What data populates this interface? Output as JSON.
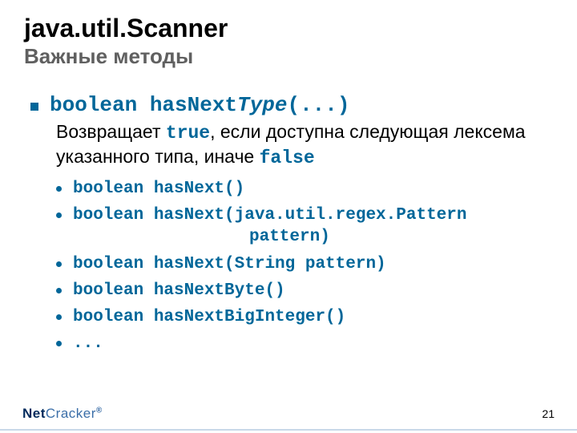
{
  "title": "java.util.Scanner",
  "subtitle": "Важные методы",
  "mainSig": {
    "prefix": "boolean hasNext",
    "ital": "Type",
    "suffix": "(...)"
  },
  "desc": {
    "t1": "Возвращает ",
    "true": "true",
    "t2": ", если доступна следующая лексема указанного типа, иначе ",
    "false": "false"
  },
  "subs": [
    {
      "line": "boolean hasNext()"
    },
    {
      "line": "boolean hasNext(java.util.regex.Pattern",
      "cont": "pattern)"
    },
    {
      "line": "boolean hasNext(String pattern)"
    },
    {
      "line": "boolean hasNextByte()"
    },
    {
      "line": "boolean hasNextBigInteger()"
    },
    {
      "line": "..."
    }
  ],
  "logo": {
    "net": "Net",
    "cracker": "Cracker",
    "reg": "®"
  },
  "page": "21"
}
